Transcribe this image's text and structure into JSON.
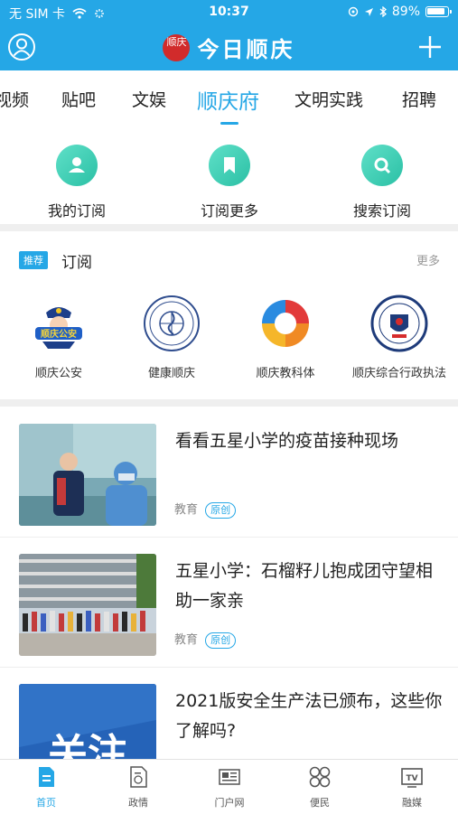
{
  "status_bar": {
    "carrier": "无 SIM 卡",
    "time": "10:37",
    "battery": "89%"
  },
  "header": {
    "logo_seal": "顺庆",
    "logo_text": "今日顺庆"
  },
  "tabs": [
    {
      "label": "视频"
    },
    {
      "label": "贴吧"
    },
    {
      "label": "文娱"
    },
    {
      "label": "顺庆府",
      "active": true
    },
    {
      "label": "文明实践"
    },
    {
      "label": "招聘"
    }
  ],
  "quick_actions": [
    {
      "label": "我的订阅",
      "icon": "user-icon"
    },
    {
      "label": "订阅更多",
      "icon": "bookmark-icon"
    },
    {
      "label": "搜索订阅",
      "icon": "search-icon"
    }
  ],
  "subscriptions": {
    "badge": "推荐",
    "title": "订阅",
    "more": "更多",
    "items": [
      {
        "name": "顺庆公安",
        "logo_text": "顺庆公安"
      },
      {
        "name": "健康顺庆"
      },
      {
        "name": "顺庆教科体"
      },
      {
        "name": "顺庆综合行政执法"
      }
    ]
  },
  "news": [
    {
      "title": "看看五星小学的疫苗接种现场",
      "category": "教育",
      "tag": "原创"
    },
    {
      "title": "五星小学：石榴籽儿抱成团守望相助一家亲",
      "category": "教育",
      "tag": "原创"
    },
    {
      "title": "2021版安全生产法已颁布，这些你了解吗?",
      "thumb_text": "关注"
    }
  ],
  "bottom_nav": [
    {
      "label": "首页",
      "icon": "home-doc-icon",
      "active": true
    },
    {
      "label": "政情",
      "icon": "government-doc-icon"
    },
    {
      "label": "门户网",
      "icon": "newspaper-icon"
    },
    {
      "label": "便民",
      "icon": "grid-icon"
    },
    {
      "label": "融媒",
      "icon": "tv-icon",
      "icon_text": "TV"
    }
  ],
  "colors": {
    "accent": "#25a7e6",
    "quick_icon": "#2bc0a5"
  }
}
